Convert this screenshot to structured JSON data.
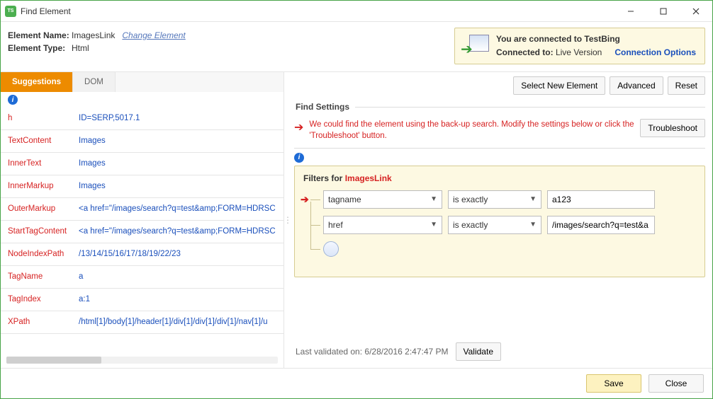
{
  "window": {
    "title": "Find Element"
  },
  "element": {
    "name_label": "Element Name:",
    "name": "ImagesLink",
    "change_link": "Change Element",
    "type_label": "Element Type:",
    "type": "Html"
  },
  "connection": {
    "top": "You are connected to TestBing",
    "connected_to_label": "Connected to:",
    "connected_to_value": "Live Version",
    "options_label": "Connection Options"
  },
  "tabs": {
    "suggestions": "Suggestions",
    "dom": "DOM"
  },
  "buttons": {
    "select_new": "Select New Element",
    "advanced": "Advanced",
    "reset": "Reset",
    "troubleshoot": "Troubleshoot",
    "validate": "Validate",
    "save": "Save",
    "close": "Close"
  },
  "find_settings": {
    "header": "Find Settings",
    "warning": "We could find the element using the back-up search. Modify the settings below or click the 'Troubleshoot' button.",
    "filters_prefix": "Filters for ",
    "filters_target": "ImagesLink",
    "filters": [
      {
        "attr": "tagname",
        "op": "is exactly",
        "value": "a123"
      },
      {
        "attr": "href",
        "op": "is exactly",
        "value": "/images/search?q=test&a"
      }
    ],
    "last_validated_label": "Last validated on:",
    "last_validated_value": "6/28/2016 2:47:47 PM"
  },
  "suggestions": [
    {
      "k": "h",
      "v": "ID=SERP,5017.1"
    },
    {
      "k": "TextContent",
      "v": "Images"
    },
    {
      "k": "InnerText",
      "v": "Images"
    },
    {
      "k": "InnerMarkup",
      "v": "Images"
    },
    {
      "k": "OuterMarkup",
      "v": "<a href=\"/images/search?q=test&amp;FORM=HDRSC"
    },
    {
      "k": "StartTagContent",
      "v": "<a href=\"/images/search?q=test&amp;FORM=HDRSC"
    },
    {
      "k": "NodeIndexPath",
      "v": "/13/14/15/16/17/18/19/22/23"
    },
    {
      "k": "TagName",
      "v": "a"
    },
    {
      "k": "TagIndex",
      "v": "a:1"
    },
    {
      "k": "XPath",
      "v": "/html[1]/body[1]/header[1]/div[1]/div[1]/div[1]/nav[1]/u"
    }
  ]
}
